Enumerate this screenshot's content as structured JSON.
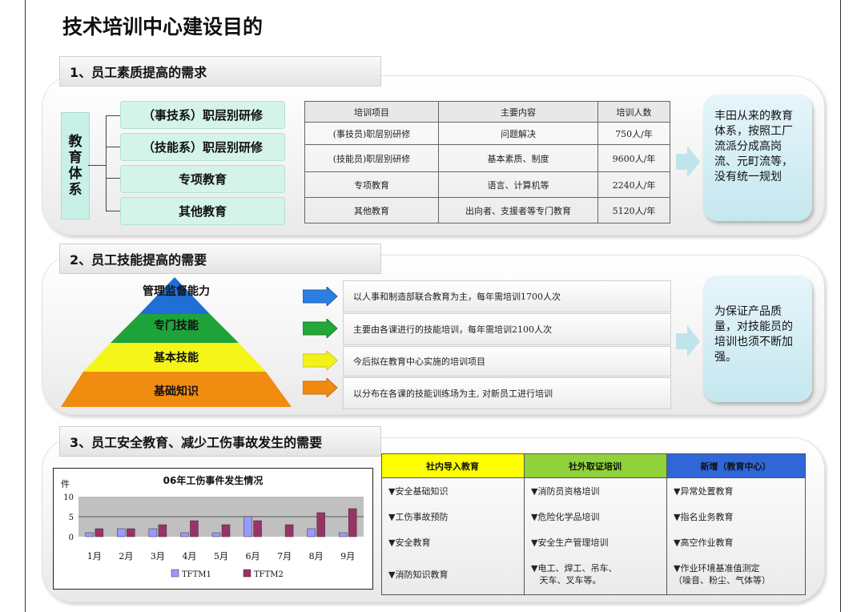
{
  "title": "技术培训中心建设目的",
  "section1": {
    "heading": "1、员工素质提高的需求",
    "vertical_label": "教育体系",
    "vertical_chars": [
      "教",
      "育",
      "体",
      "系"
    ],
    "branches": [
      "（事技系）职层别研修",
      "（技能系）职层别研修",
      "专项教育",
      "其他教育"
    ],
    "table": {
      "headers": [
        "培训项目",
        "主要内容",
        "培训人数"
      ],
      "rows": [
        [
          "(事技员)职层别研修",
          "问题解决",
          "750人/年"
        ],
        [
          "(技能员)职层别研修",
          "基本素质、制度",
          "9600人/年"
        ],
        [
          "专项教育",
          "语言、计算机等",
          "2240人/年"
        ],
        [
          "其他教育",
          "出向者、支援者等专门教育",
          "5120人/年"
        ]
      ]
    },
    "note": "丰田从来的教育体系，按照工厂流派分成高岗流、元町流等，没有统一规划"
  },
  "section2": {
    "heading": "2、员工技能提高的需要",
    "pyramid": [
      "管理监督能力",
      "专门技能",
      "基本技能",
      "基础知识"
    ],
    "pyramid_colors": [
      "#1f6fd6",
      "#1ea33a",
      "#f5f51a",
      "#f08c10"
    ],
    "arrow_colors": [
      "#2a7fe0",
      "#22a838",
      "#f2f21a",
      "#f08a10"
    ],
    "rows": [
      "以人事和制造部联合教育为主，每年需培训1700人次",
      "主要由各课进行的技能培训，每年需培训2100人次",
      "今后拟在教育中心实施的培训项目",
      "以分布在各课的技能训练场为主, 对新员工进行培训"
    ],
    "note": "为保证产品质量，对技能员的培训也须不断加强。"
  },
  "section3": {
    "heading": "3、员工安全教育、减少工伤事故发生的需要",
    "columns": [
      {
        "header": "社内导入教育",
        "color": "#ffff00",
        "items": [
          "▼安全基础知识",
          "▼工伤事故预防",
          "▼安全教育",
          "▼消防知识教育"
        ]
      },
      {
        "header": "社外取证培训",
        "color": "#8fd23a",
        "items": [
          "▼消防员资格培训",
          "▼危险化学品培训",
          "▼安全生产管理培训",
          "▼电工、焊工、吊车、\n   天车、叉车等。"
        ]
      },
      {
        "header": "新增（教育中心）",
        "color": "#2f67d8",
        "items": [
          "▼异常处置教育",
          "▼指名业务教育",
          "▼高空作业教育",
          "▼作业环境基准值测定\n（噪音、粉尘、气体等）"
        ]
      }
    ]
  },
  "chart_data": {
    "type": "bar",
    "title": "06年工伤事件发生情况",
    "ylabel": "件",
    "ylim": [
      0,
      10
    ],
    "yticks": [
      0,
      5,
      10
    ],
    "categories": [
      "1月",
      "2月",
      "3月",
      "4月",
      "5月",
      "6月",
      "7月",
      "8月",
      "9月"
    ],
    "series": [
      {
        "name": "TFTM1",
        "color": "#9999ff",
        "values": [
          1,
          2,
          2,
          1,
          1,
          5,
          0,
          2,
          1
        ]
      },
      {
        "name": "TFTM2",
        "color": "#993366",
        "values": [
          2,
          2,
          3,
          4,
          3,
          4,
          3,
          6,
          7
        ]
      }
    ],
    "legend": "bottom"
  }
}
